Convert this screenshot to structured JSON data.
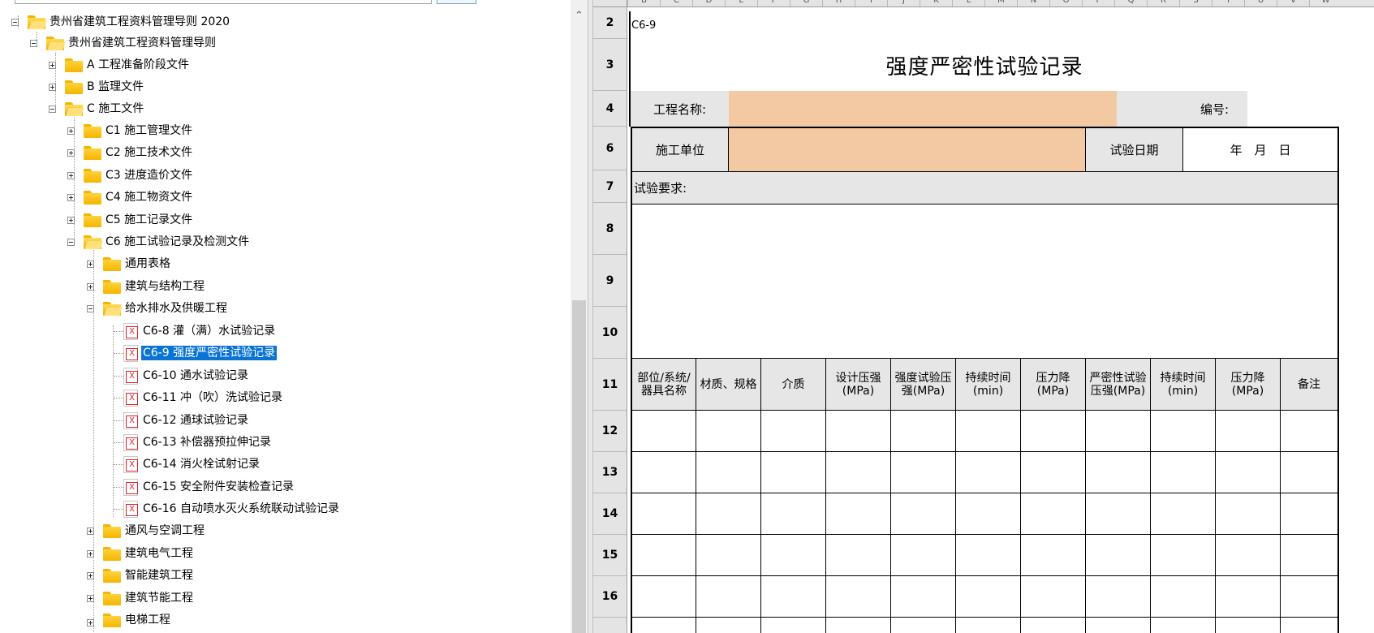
{
  "tree": {
    "root": "贵州省建筑工程资料管理导则 2020",
    "guide": "贵州省建筑工程资料管理导则",
    "a": "A 工程准备阶段文件",
    "b": "B 监理文件",
    "c": "C 施工文件",
    "c1": "C1 施工管理文件",
    "c2": "C2 施工技术文件",
    "c3": "C3 进度造价文件",
    "c4": "C4 施工物资文件",
    "c5": "C5 施工记录文件",
    "c6": "C6 施工试验记录及检测文件",
    "general": "通用表格",
    "arch": "建筑与结构工程",
    "plumbing": "给水排水及供暖工程",
    "f68": "C6-8 灌（满）水试验记录",
    "f69": "C6-9 强度严密性试验记录",
    "f610": "C6-10 通水试验记录",
    "f611": "C6-11 冲（吹）洗试验记录",
    "f612": "C6-12 通球试验记录",
    "f613": "C6-13 补偿器预拉伸记录",
    "f614": "C6-14 消火栓试射记录",
    "f615": "C6-15 安全附件安装检查记录",
    "f616": "C6-16 自动喷水灭火系统联动试验记录",
    "hvac": "通风与空调工程",
    "elec": "建筑电气工程",
    "smart": "智能建筑工程",
    "energy": "建筑节能工程",
    "elevator": "电梯工程"
  },
  "sheet": {
    "columns": [
      "B",
      "C",
      "D",
      "E",
      "F",
      "G",
      "H",
      "I",
      "J",
      "K",
      "L",
      "M",
      "N",
      "O",
      "P",
      "Q",
      "R",
      "S",
      "T",
      "U",
      "V",
      "W"
    ],
    "rows": [
      "2",
      "3",
      "4",
      "6",
      "7",
      "8",
      "9",
      "10",
      "11",
      "12",
      "13",
      "14",
      "15",
      "16"
    ],
    "code": "C6-9",
    "title": "强度严密性试验记录",
    "project_name_label": "工程名称:",
    "number_label": "编号:",
    "construction_unit_label": "施工单位",
    "test_date_label": "试验日期",
    "date_placeholder": "年　月　日",
    "requirements_label": "试验要求:",
    "table_headers": [
      "部位/系统/器具名称",
      "材质、规格",
      "介质",
      "设计压强(MPa)",
      "强度试验压强(MPa)",
      "持续时间(min)",
      "压力降(MPa)",
      "严密性试验压强(MPa)",
      "持续时间(min)",
      "压力降(MPa)",
      "备注"
    ]
  },
  "colors": {
    "selection": "#0a74d6",
    "input_fill": "#f3c9a4",
    "label_fill": "#e6e6e6",
    "folder": "#f5b400"
  }
}
